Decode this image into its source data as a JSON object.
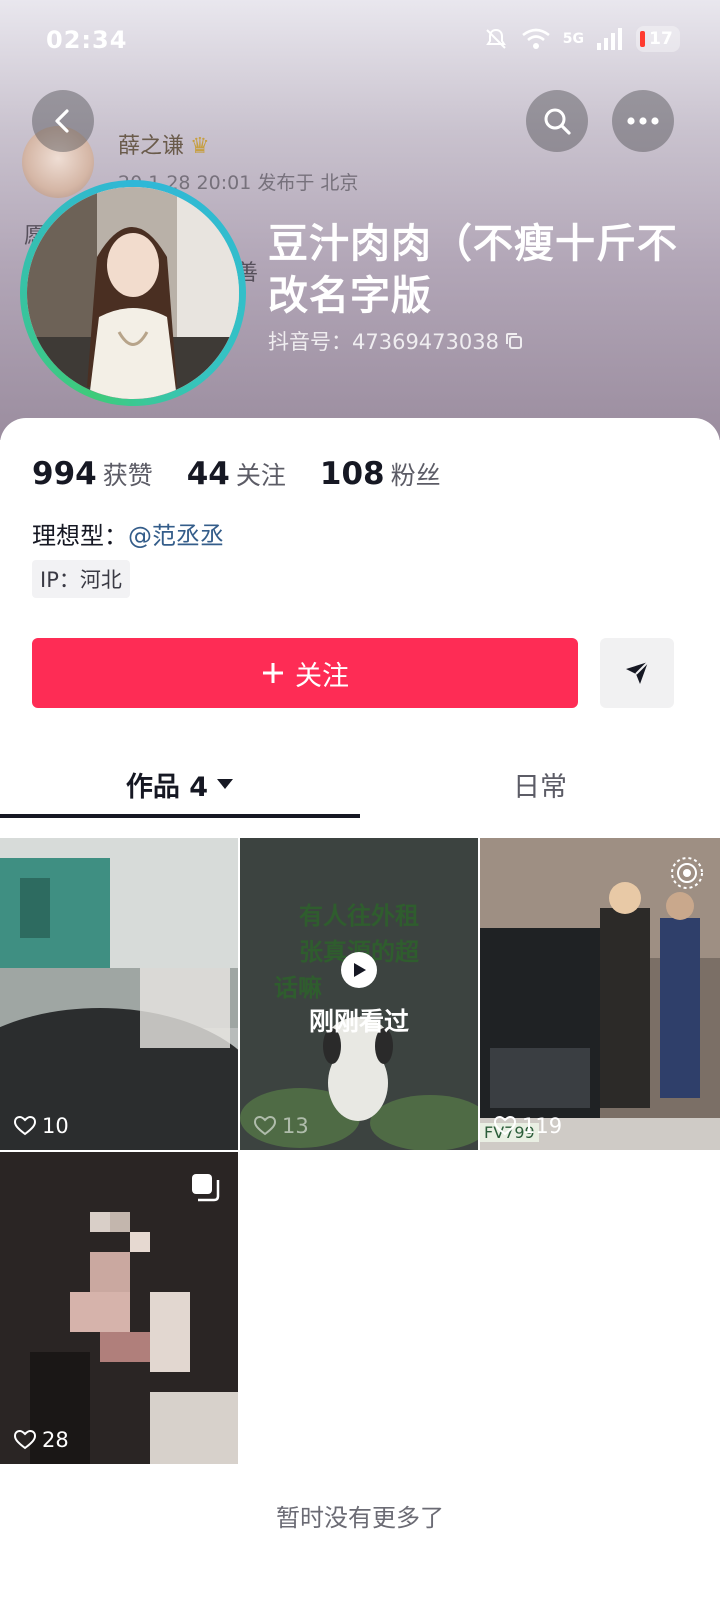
{
  "status_bar": {
    "time": "02:34",
    "network": "5G",
    "battery": "17"
  },
  "background_post": {
    "author": "薛之谦",
    "meta": "20 1 28 20:01  发布于 北京",
    "side_text_left": "愿",
    "side_text_right": "善"
  },
  "profile": {
    "nickname": "豆汁肉肉（不瘦十斤不改名字版",
    "douyin_id": "抖音号：47369473038"
  },
  "stats": [
    {
      "value": "994",
      "label": "获赞"
    },
    {
      "value": "44",
      "label": "关注"
    },
    {
      "value": "108",
      "label": "粉丝"
    }
  ],
  "bio": {
    "prefix": "理想型：",
    "mention": "@范丞丞"
  },
  "ip": "IP：河北",
  "actions": {
    "follow": "关注",
    "follow_icon": "plus-icon",
    "share_icon": "send-icon"
  },
  "tabs": {
    "works": "作品 4",
    "daily": "日常"
  },
  "videos": [
    {
      "likes": "10",
      "overlay": "",
      "badge": ""
    },
    {
      "likes": "13",
      "overlay_lines": [
        "有人往外租",
        "张真源的超",
        "话嘛"
      ],
      "watched": "刚刚看过",
      "badge": ""
    },
    {
      "likes": "119",
      "overlay": "",
      "plate": "FV799",
      "badge": "live-photo-icon"
    },
    {
      "likes": "28",
      "overlay": "",
      "badge": "gallery-icon"
    }
  ],
  "footer_text": "暂时没有更多了",
  "colors": {
    "accent": "#fe2c55",
    "link": "#345d8a",
    "ring": "#2fb7d8"
  }
}
